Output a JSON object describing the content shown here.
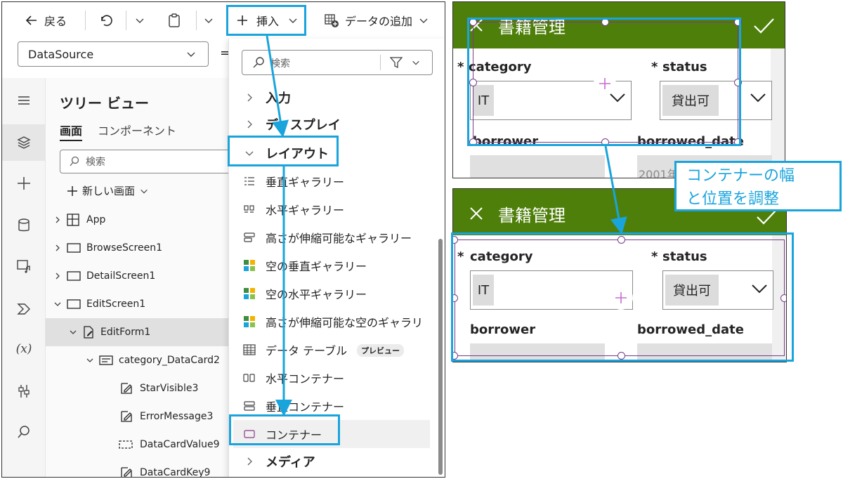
{
  "toolbar": {
    "back_label": "戻る",
    "insert_label": "挿入",
    "add_data_label": "データの追加"
  },
  "property_selector": {
    "value": "DataSource"
  },
  "tree_view": {
    "title": "ツリー ビュー",
    "tabs": [
      "画面",
      "コンポーネント"
    ],
    "search_placeholder": "検索",
    "new_screen_label": "新しい画面",
    "items": [
      "App",
      "BrowseScreen1",
      "DetailScreen1",
      "EditScreen1",
      "EditForm1",
      "category_DataCard2",
      "StarVisible3",
      "ErrorMessage3",
      "DataCardValue9",
      "DataCardKey9"
    ]
  },
  "insert_panel": {
    "search_placeholder": "検索",
    "categories": {
      "input": "入力",
      "display": "ディスプレイ",
      "layout": "レイアウト",
      "media": "メディア"
    },
    "layout_items": [
      "垂直ギャラリー",
      "水平ギャラリー",
      "高さが伸縮可能なギャラリー",
      "空の垂直ギャラリー",
      "空の水平ギャラリー",
      "高さが伸縮可能な空のギャラリ",
      "データ テーブル",
      "水平コンテナー",
      "垂直コンテナー",
      "コンテナー"
    ],
    "preview_badge": "プレビュー"
  },
  "form_before": {
    "title": "書籍管理",
    "required_mark": "*",
    "field_category": "category",
    "field_status": "status",
    "category_value": "IT",
    "status_value": "貸出可",
    "field_borrower": "borrower",
    "field_borrowed_date": "borrowed_date",
    "date_value_partial": "2001年"
  },
  "form_after": {
    "title": "書籍管理",
    "required_mark": "*",
    "field_category": "category",
    "field_status": "status",
    "category_value": "IT",
    "status_value": "貸出可",
    "field_borrower": "borrower",
    "field_borrowed_date": "borrowed_date"
  },
  "callout": {
    "line1": "コンテナーの幅",
    "line2": "と位置を調整"
  },
  "colors": {
    "header_green": "#4e7f0a",
    "highlight_blue": "#1aa4dc",
    "selection_purple": "#7a3a8a",
    "add_pink": "#c86bd0"
  }
}
